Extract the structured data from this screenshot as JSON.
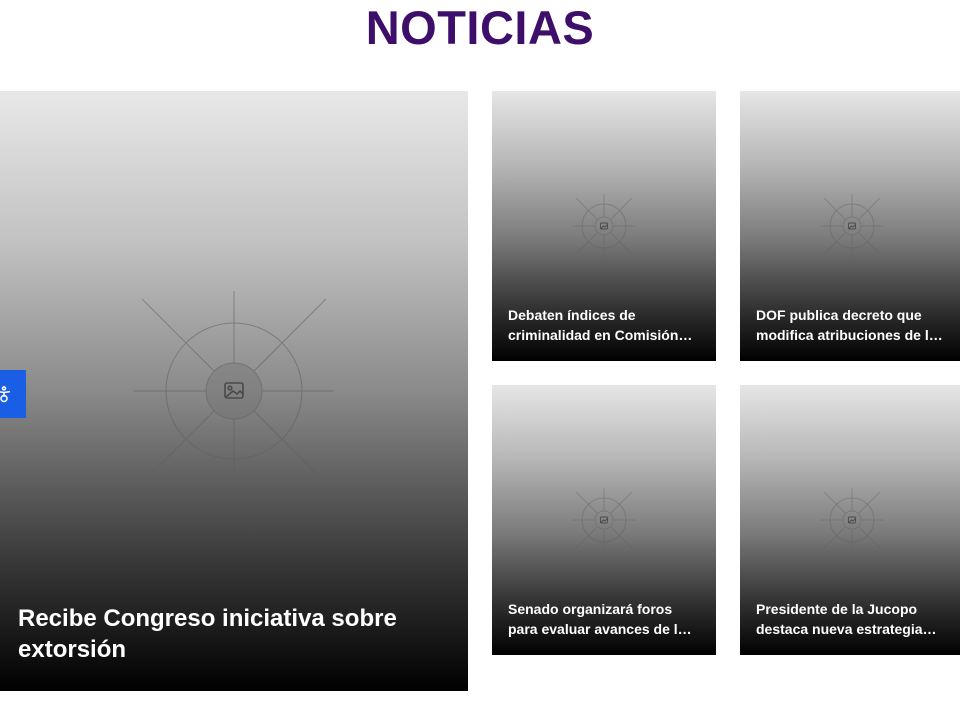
{
  "section": {
    "title": "NOTICIAS"
  },
  "featured": {
    "title": "Recibe Congreso iniciativa sobre extorsión",
    "image_icon": "image-placeholder-icon"
  },
  "news": [
    {
      "title": "Debaten índices de criminalidad en Comisión de Seguridad",
      "display": "Debaten índices de criminalidad en Comisión…",
      "image_icon": "image-placeholder-icon"
    },
    {
      "title": "DOF publica decreto que modifica atribuciones de la",
      "display": "DOF publica decreto que modifica atribuciones de l…",
      "image_icon": "image-placeholder-icon"
    },
    {
      "title": "Senado organizará foros para evaluar avances de la",
      "display": "Senado organizará foros para evaluar avances de l…",
      "image_icon": "image-placeholder-icon"
    },
    {
      "title": "Presidente de la Jucopo destaca nueva estrategia",
      "display": "Presidente de la Jucopo destaca nueva estrategia…",
      "image_icon": "image-placeholder-icon"
    }
  ],
  "accessibility": {
    "icon": "accessibility-icon"
  },
  "colors": {
    "title": "#3d0f6b",
    "accessibility_button": "#1a5ee6",
    "card_text": "#ffffff"
  }
}
